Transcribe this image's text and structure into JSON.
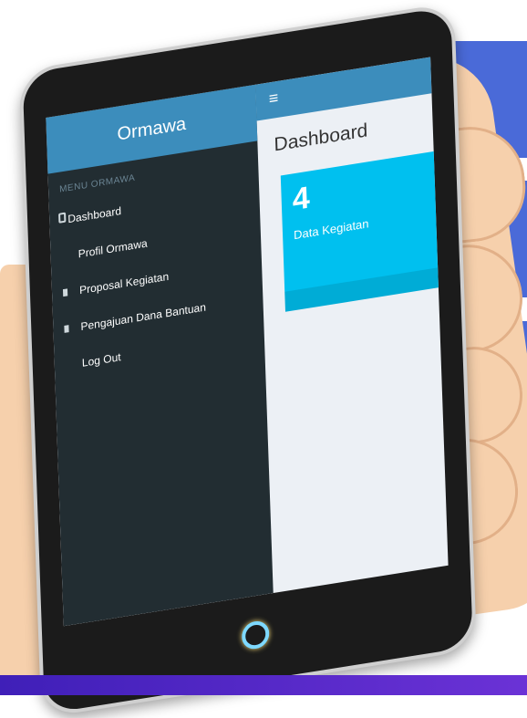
{
  "app": {
    "brand": "Ormawa",
    "toolbar": {
      "menu_icon": "hamburger-icon"
    }
  },
  "sidebar": {
    "header": "MENU ORMAWA",
    "items": [
      {
        "label": "Dashboard",
        "icon": "dashboard-icon",
        "active": true
      },
      {
        "label": "Profil Ormawa",
        "icon": ""
      },
      {
        "label": "Proposal Kegiatan",
        "icon": "document-icon"
      },
      {
        "label": "Pengajuan Dana Bantuan",
        "icon": "document-icon"
      },
      {
        "label": "Log Out",
        "icon": ""
      }
    ]
  },
  "main": {
    "title": "Dashboard",
    "info_box": {
      "count": "4",
      "label": "Data Kegiatan"
    }
  },
  "colors": {
    "header": "#3c8dbc",
    "sidebar": "#222d32",
    "info_box": "#00c0ef",
    "content_bg": "#ecf0f5",
    "background_band": "#4a6ad8"
  }
}
